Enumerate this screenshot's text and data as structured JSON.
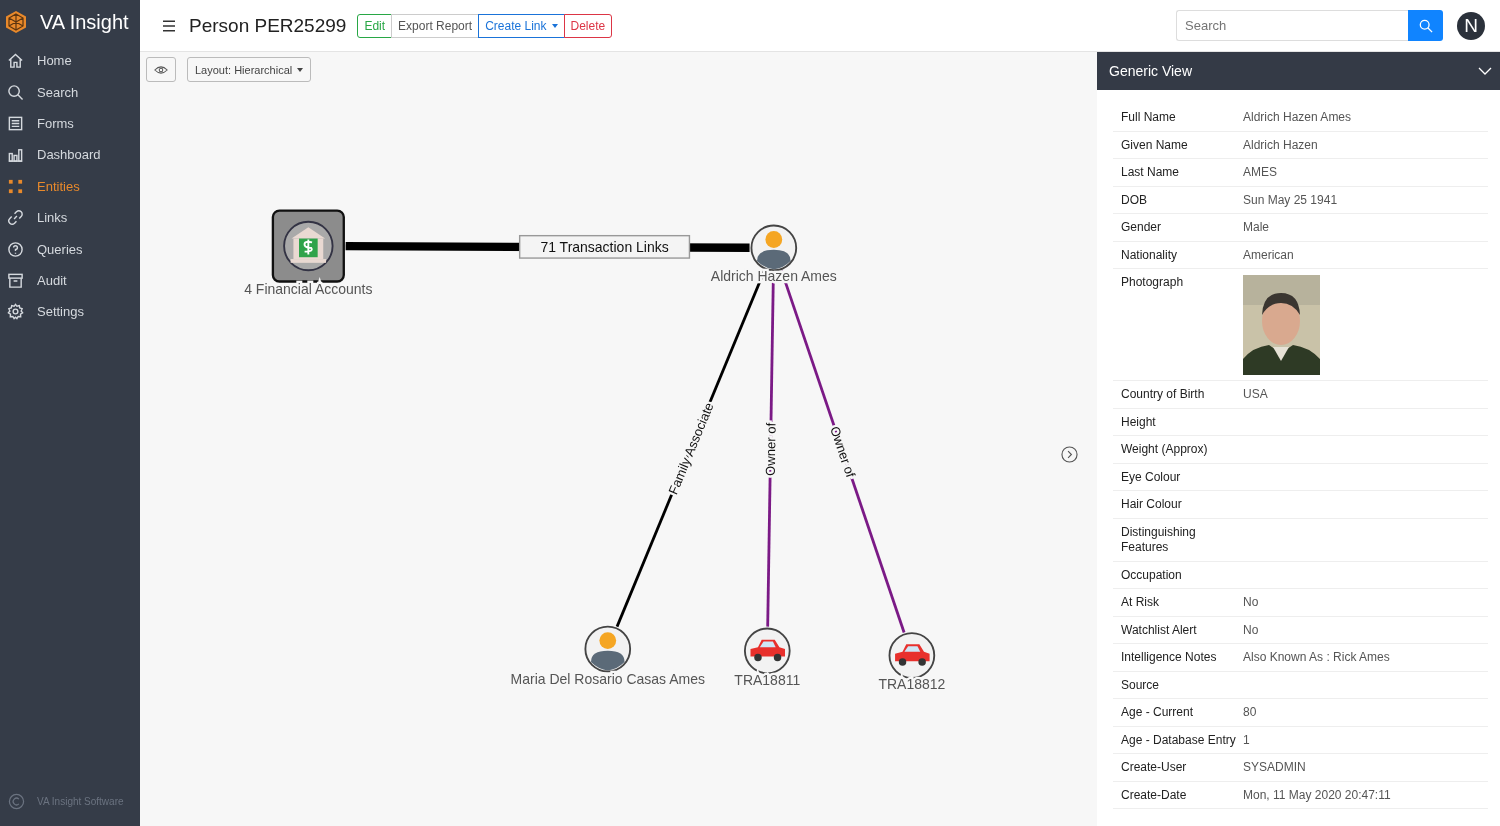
{
  "app": {
    "name": "VA Insight",
    "footer": "VA Insight Software"
  },
  "sidebar": {
    "items": [
      {
        "label": "Home",
        "selected": false
      },
      {
        "label": "Search",
        "selected": false
      },
      {
        "label": "Forms",
        "selected": false
      },
      {
        "label": "Dashboard",
        "selected": false
      },
      {
        "label": "Entities",
        "selected": true
      },
      {
        "label": "Links",
        "selected": false
      },
      {
        "label": "Queries",
        "selected": false
      },
      {
        "label": "Audit",
        "selected": false
      },
      {
        "label": "Settings",
        "selected": false
      }
    ]
  },
  "header": {
    "title": "Person PER25299",
    "buttons": [
      {
        "label": "Edit",
        "kind": "success"
      },
      {
        "label": "Export Report",
        "kind": "plain"
      },
      {
        "label": "Create Link",
        "kind": "primary",
        "dropdown": true
      },
      {
        "label": "Delete",
        "kind": "danger"
      }
    ],
    "search": {
      "placeholder": "Search"
    },
    "avatar": "N"
  },
  "toolbar": {
    "layout": "Layout: Hierarchical"
  },
  "graph": {
    "nodes": [
      {
        "label": "4 Financial Accounts",
        "kind": "account"
      },
      {
        "label": "Aldrich Hazen Ames",
        "kind": "person"
      },
      {
        "label": "Maria Del Rosario Casas Ames",
        "kind": "person"
      },
      {
        "label": "TRA18811",
        "kind": "car"
      },
      {
        "label": "TRA18812",
        "kind": "car"
      }
    ],
    "edges": [
      {
        "label": "71 Transaction Links",
        "kind": "thick",
        "color": "#000000"
      },
      {
        "label": "Family Associate",
        "kind": "thin",
        "color": "#000000"
      },
      {
        "label": "Owner of",
        "kind": "thin",
        "color": "#7b1a86"
      },
      {
        "label": "Owner of",
        "kind": "thin",
        "color": "#7b1a86"
      }
    ]
  },
  "panel": {
    "title": "Generic View",
    "expanded": true,
    "rows": [
      {
        "label": "Full Name",
        "value": "Aldrich Hazen Ames"
      },
      {
        "label": "Given Name",
        "value": "Aldrich Hazen"
      },
      {
        "label": "Last Name",
        "value": "AMES"
      },
      {
        "label": "DOB",
        "value": "Sun May 25 1941"
      },
      {
        "label": "Gender",
        "value": "Male"
      },
      {
        "label": "Nationality",
        "value": "American"
      },
      {
        "label": "Photograph",
        "kind": "picture"
      },
      {
        "label": "Country of Birth",
        "value": "USA"
      },
      {
        "label": "Height"
      },
      {
        "label": "Weight (Approx)"
      },
      {
        "label": "Eye Colour"
      },
      {
        "label": "Hair Colour"
      },
      {
        "label": "Distinguishing Features"
      },
      {
        "label": "Occupation"
      },
      {
        "label": "At Risk",
        "value": "No"
      },
      {
        "label": "Watchlist Alert",
        "value": "No"
      },
      {
        "label": "Intelligence Notes",
        "value": "Also Known As : Rick Ames"
      },
      {
        "label": "Source"
      },
      {
        "label": "Age - Current",
        "value": "80"
      },
      {
        "label": "Age - Database Entry",
        "value": "1"
      },
      {
        "label": "Create-User",
        "value": "SYSADMIN"
      },
      {
        "label": "Create-Date",
        "value": "Mon, 11 May 2020 20:47:11"
      }
    ]
  }
}
